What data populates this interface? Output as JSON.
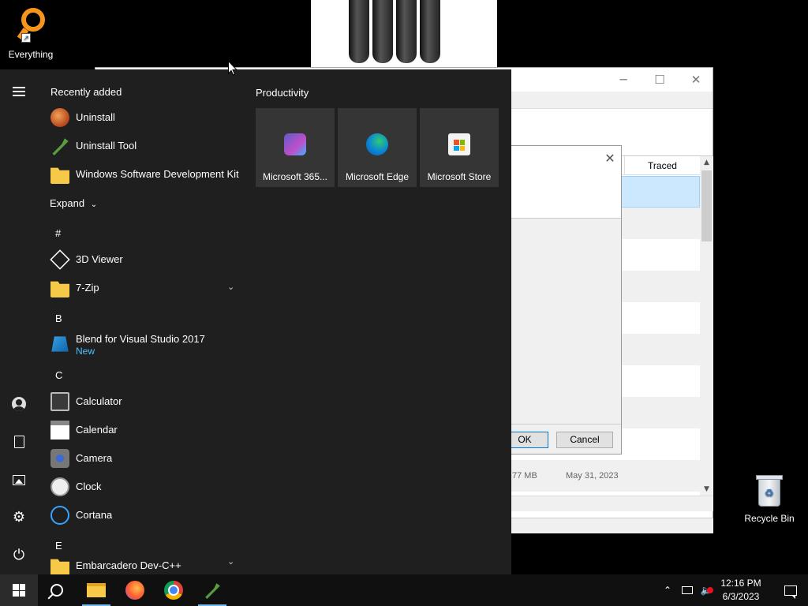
{
  "desktop": {
    "everything_label": "Everything",
    "recycle_label": "Recycle Bin"
  },
  "bg_window": {
    "column_traced": "Traced",
    "row_size": "77 MB",
    "row_date": "May 31, 2023"
  },
  "dialog": {
    "ok_label": "OK",
    "cancel_label": "Cancel"
  },
  "start_menu": {
    "recently_added": "Recently added",
    "recent": [
      {
        "label": "Uninstall",
        "icon": "uninstall-icon"
      },
      {
        "label": "Uninstall Tool",
        "icon": "uninstall-tool-icon"
      },
      {
        "label": "Windows Software Development Kit",
        "icon": "folder-icon"
      }
    ],
    "expand_label": "Expand",
    "letters": {
      "hash": "#",
      "b": "B",
      "c": "C",
      "e": "E"
    },
    "apps": [
      {
        "label": "3D Viewer",
        "icon": "cube-icon"
      },
      {
        "label": "7-Zip",
        "icon": "folder-icon"
      },
      {
        "label": "Blend for Visual Studio 2017",
        "sub": "New",
        "icon": "blend-icon"
      },
      {
        "label": "Calculator",
        "icon": "calculator-icon"
      },
      {
        "label": "Calendar",
        "icon": "calendar-icon"
      },
      {
        "label": "Camera",
        "icon": "camera-icon"
      },
      {
        "label": "Clock",
        "icon": "clock-icon"
      },
      {
        "label": "Cortana",
        "icon": "cortana-icon"
      },
      {
        "label": "Embarcadero Dev-C++",
        "icon": "folder-icon"
      }
    ],
    "tiles_title": "Productivity",
    "tiles": [
      {
        "label": "Microsoft 365...",
        "icon": "microsoft-365-icon"
      },
      {
        "label": "Microsoft Edge",
        "icon": "edge-icon"
      },
      {
        "label": "Microsoft Store",
        "icon": "store-icon"
      }
    ]
  },
  "taskbar": {
    "time": "12:16 PM",
    "date": "6/3/2023"
  },
  "colors": {
    "accent": "#76b9ed",
    "start_bg": "#1f1f1f",
    "tile_bg": "#353535",
    "taskbar_bg": "#101010",
    "new_badge": "#4cc2ff"
  }
}
